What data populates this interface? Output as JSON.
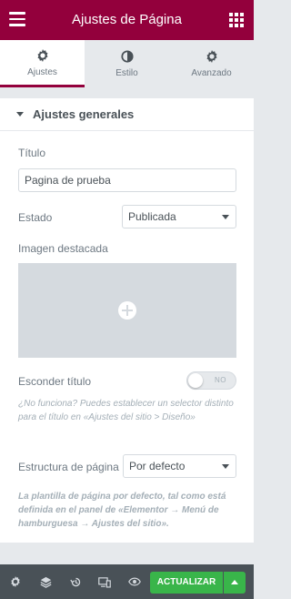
{
  "header": {
    "title": "Ajustes de Página",
    "menu_icon": "hamburger-icon",
    "apps_icon": "grid-icon"
  },
  "tabs": [
    {
      "label": "Ajustes",
      "icon": "gear-icon",
      "active": true
    },
    {
      "label": "Estilo",
      "icon": "contrast-icon",
      "active": false
    },
    {
      "label": "Avanzado",
      "icon": "gear-icon",
      "active": false
    }
  ],
  "section": {
    "title": "Ajustes generales"
  },
  "fields": {
    "title_label": "Título",
    "title_value": "Pagina de prueba",
    "status_label": "Estado",
    "status_value": "Publicada",
    "featured_image_label": "Imagen destacada",
    "hide_title_label": "Esconder título",
    "hide_title_toggle": "NO",
    "hide_title_hint": "¿No funciona? Puedes establecer un selector distinto para el título en «Ajustes del sitio > Diseño»",
    "layout_label": "Estructura de página",
    "layout_value": "Por defecto",
    "layout_hint": "La plantilla de página por defecto, tal como está definida en el panel de «Elementor → Menú de hamburguesa → Ajustes del sitio»."
  },
  "footer": {
    "update_label": "ACTUALIZAR",
    "icons": [
      "gear-icon",
      "layers-icon",
      "history-icon",
      "responsive-icon",
      "eye-icon"
    ]
  },
  "colors": {
    "accent": "#93003c",
    "update": "#39b54a",
    "footer": "#495157",
    "panel": "#e6e9ec"
  }
}
